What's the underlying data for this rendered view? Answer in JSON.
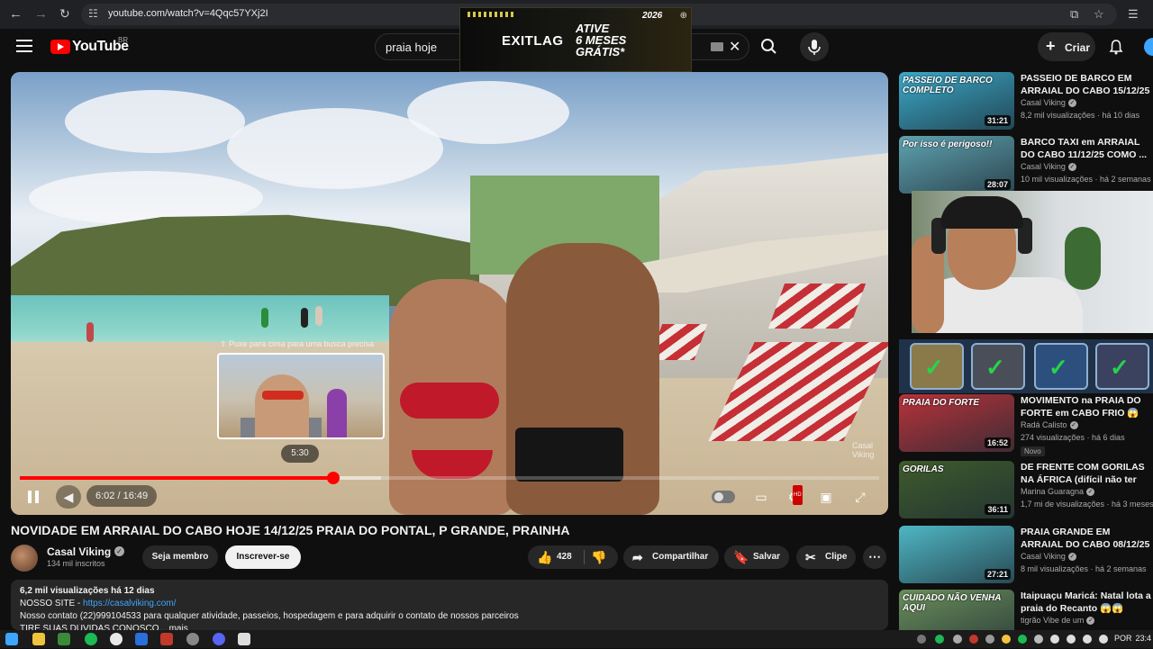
{
  "browser": {
    "url": "youtube.com/watch?v=4Qqc57YXj2I",
    "back_icon": "arrow-left-icon",
    "forward_icon": "arrow-right-icon",
    "reload_icon": "reload-icon",
    "actions": [
      "cast-icon",
      "bookmark-star-icon",
      "reading-list-icon"
    ]
  },
  "ad": {
    "brand": "EXITLAG",
    "cta_line1": "ATIVE",
    "cta_line2": "6 MESES",
    "cta_line3": "GRÁTIS*",
    "year": "2026"
  },
  "header": {
    "logo_text": "YouTube",
    "country_code": "BR",
    "search_query": "praia hoje",
    "create_label": "Criar"
  },
  "player": {
    "preview_hint": "⇧ Puxe para cima para uma busca precisa",
    "preview_time": "5:30",
    "time_display": "6:02 / 16:49",
    "played_fraction": 0.365,
    "loaded_fraction": 0.42,
    "watermark": "Casal Viking"
  },
  "video": {
    "title": "NOVIDADE EM ARRAIAL DO CABO HOJE 14/12/25 PRAIA DO PONTAL, P GRANDE, PRAINHA",
    "channel": "Casal Viking",
    "subscribers": "134 mil inscritos",
    "member_label": "Seja membro",
    "subscribe_label": "Inscrever-se",
    "likes": "428",
    "share_label": "Compartilhar",
    "save_label": "Salvar",
    "clip_label": "Clipe"
  },
  "description": {
    "stats": "6,2 mil visualizações  há 12 dias",
    "site_prefix": "NOSSO SITE - ",
    "site_link": "https://casalviking.com/",
    "contact": "Nosso contato (22)999104533 para qualquer atividade, passeios, hospedagem e para adquirir o contato de nossos parceiros",
    "more_line": "TIRE SUAS DÚVIDAS CONOSCO...   mais"
  },
  "recommendations": [
    {
      "thumb_text": "PASSEIO DE BARCO COMPLETO",
      "duration": "31:21",
      "title": "PASSEIO DE BARCO EM ARRAIAL DO CABO 15/12/25",
      "channel": "Casal Viking",
      "meta": "8,2 mil visualizações · há 10 dias",
      "color": "#3aa8c8"
    },
    {
      "thumb_text": "Por isso é perigoso!!",
      "duration": "28:07",
      "title": "BARCO TAXI em ARRAIAL DO CABO 11/12/25 COMO ...",
      "channel": "Casal Viking",
      "meta": "10 mil visualizações · há 2 semanas",
      "color": "#5fa2b0"
    },
    {
      "thumb_text": "PRAIA DO FORTE",
      "duration": "16:52",
      "title": "MOVIMENTO na PRAIA DO FORTE em CABO FRIO 😱",
      "channel": "Radá Calisto",
      "meta": "274 visualizações · há 6 dias",
      "badge": "Novo",
      "color": "#b8323a"
    },
    {
      "thumb_text": "GORILAS",
      "duration": "36:11",
      "title": "DE FRENTE COM GORILAS NA ÁFRICA (difícil não ter medo)",
      "channel": "Marina Guaragna",
      "meta": "1,7 mi de visualizações · há 3 meses",
      "color": "#3f5b2c"
    },
    {
      "thumb_text": "",
      "duration": "27:21",
      "title": "PRAIA GRANDE EM ARRAIAL DO CABO 08/12/25",
      "channel": "Casal Viking",
      "meta": "8 mil visualizações · há 2 semanas",
      "color": "#4fb6c4"
    },
    {
      "thumb_text": "CUIDADO NÃO VENHA AQUI",
      "duration": "",
      "title": "Itaipuaçu Maricá: Natal lota a praia do Recanto 😱😱",
      "channel": "tigrão Vibe de um",
      "meta": "",
      "color": "#6a8e5a"
    }
  ],
  "taskbar": {
    "language": "POR",
    "clock": "23:4"
  }
}
